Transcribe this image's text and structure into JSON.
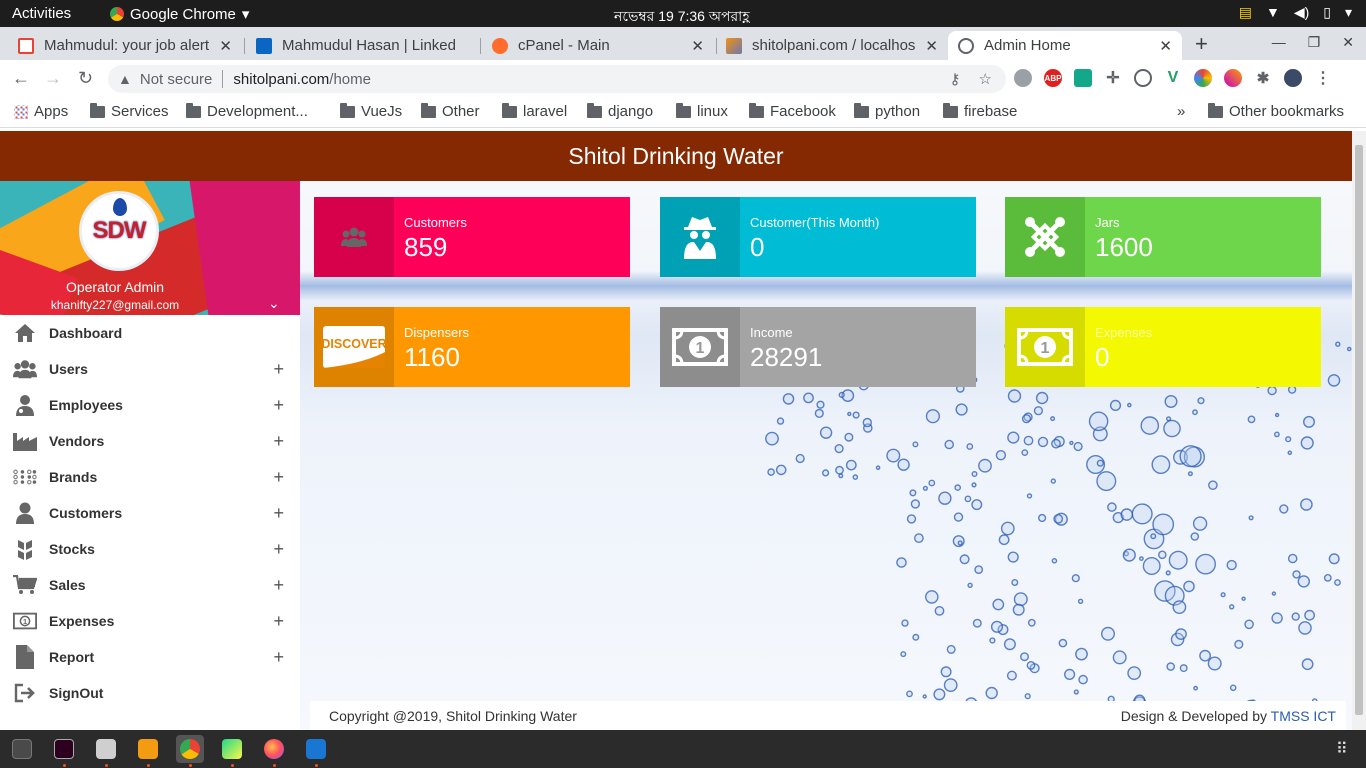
{
  "system": {
    "activities": "Activities",
    "app_name": "Google Chrome",
    "clock": "নভেম্বর 19  7:36 অপরাহ্ণ"
  },
  "tabs": [
    {
      "title": "Mahmudul: your job alert",
      "icon": "gmail-icon",
      "color": "#ea4335"
    },
    {
      "title": "Mahmudul Hasan | Linked",
      "icon": "linkedin-icon",
      "color": "#0a66c2"
    },
    {
      "title": "cPanel - Main",
      "icon": "cpanel-icon",
      "color": "#ff6c2c"
    },
    {
      "title": "shitolpani.com / localhos",
      "icon": "phpmyadmin-icon",
      "color": "#f29111"
    },
    {
      "title": "Admin Home",
      "icon": "globe-icon",
      "color": "#5f6368"
    }
  ],
  "omnibox": {
    "security": "Not secure",
    "host": "shitolpani.com",
    "path": "/home"
  },
  "bookmarks": {
    "apps": "Apps",
    "items": [
      "Services",
      "Development...",
      "VueJs",
      "Other",
      "laravel",
      "django",
      "linux",
      "Facebook",
      "python",
      "firebase"
    ],
    "more": "»",
    "other": "Other bookmarks"
  },
  "header": {
    "title": "Shitol Drinking Water"
  },
  "profile": {
    "logo_text": "SDW",
    "name": "Operator Admin",
    "email": "khanifty227@gmail.com"
  },
  "menu": [
    {
      "label": "Dashboard",
      "icon": "home-icon",
      "expandable": false
    },
    {
      "label": "Users",
      "icon": "users-icon",
      "expandable": true
    },
    {
      "label": "Employees",
      "icon": "employee-icon",
      "expandable": true
    },
    {
      "label": "Vendors",
      "icon": "factory-icon",
      "expandable": true
    },
    {
      "label": "Brands",
      "icon": "dots-grid-icon",
      "expandable": true
    },
    {
      "label": "Customers",
      "icon": "user-icon",
      "expandable": true
    },
    {
      "label": "Stocks",
      "icon": "cubes-icon",
      "expandable": true
    },
    {
      "label": "Sales",
      "icon": "cart-icon",
      "expandable": true
    },
    {
      "label": "Expenses",
      "icon": "money-icon",
      "expandable": true
    },
    {
      "label": "Report",
      "icon": "file-icon",
      "expandable": true
    },
    {
      "label": "SignOut",
      "icon": "signout-icon",
      "expandable": false
    }
  ],
  "cards": [
    {
      "label": "Customers",
      "value": "859",
      "icon": "users-icon",
      "color": "#ff0059",
      "icon_bg": "#d6004b"
    },
    {
      "label": "Customer(This Month)",
      "value": "0",
      "icon": "spy-icon",
      "color": "#00bcd4",
      "icon_bg": "#00a1b5"
    },
    {
      "label": "Jars",
      "value": "1600",
      "icon": "joomla-icon",
      "color": "#6ed64a",
      "icon_bg": "#5bbb3a"
    },
    {
      "label": "Dispensers",
      "value": "1160",
      "icon": "discover-card-icon",
      "color": "#ff9800",
      "icon_bg": "#dd8300"
    },
    {
      "label": "Income",
      "value": "28291",
      "icon": "money-bill-icon",
      "color": "#a4a4a4",
      "icon_bg": "#8d8d8d"
    },
    {
      "label": "Expenses",
      "value": "0",
      "icon": "money-bill-icon",
      "color": "#f4f902",
      "icon_bg": "#d6dc00"
    }
  ],
  "footer": {
    "copyright": "Copyright @2019, Shitol Drinking Water",
    "credit_prefix": "Design & Developed by",
    "credit_link": "TMSS ICT"
  }
}
